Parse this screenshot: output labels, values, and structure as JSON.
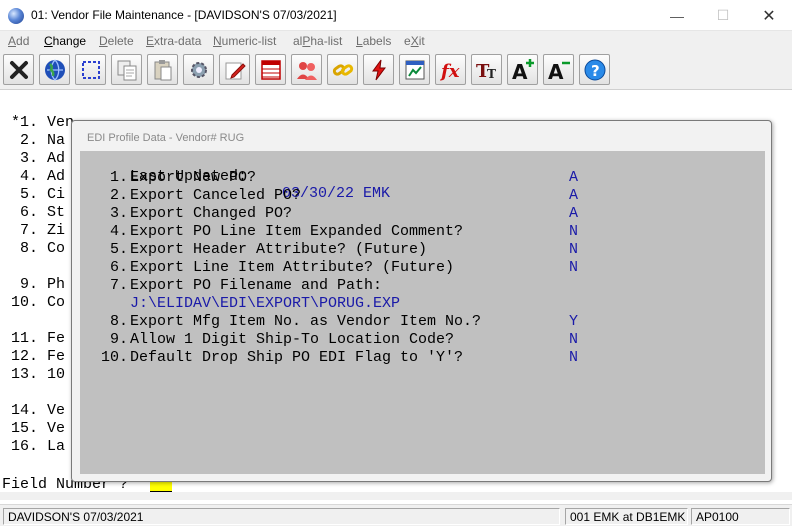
{
  "window": {
    "title": "01: Vendor File Maintenance - [DAVIDSON'S 07/03/2021]",
    "minimize_glyph": "—",
    "maximize_glyph": "☐",
    "close_glyph": "✕"
  },
  "menu": [
    {
      "label": "Add",
      "active": false
    },
    {
      "label": "Change",
      "active": true
    },
    {
      "label": "Delete",
      "active": false
    },
    {
      "label": "Extra-data",
      "active": false
    },
    {
      "label": "Numeric-list",
      "active": false
    },
    {
      "label": "alPha-list",
      "active": false
    },
    {
      "label": "Labels",
      "active": false
    },
    {
      "label": "eXit",
      "active": false
    }
  ],
  "toolbar": [
    {
      "icon": "close-x-icon"
    },
    {
      "icon": "globe-icon"
    },
    {
      "icon": "select-rectangle-icon"
    },
    {
      "icon": "copy-icon"
    },
    {
      "icon": "paste-icon"
    },
    {
      "icon": "settings-gear-icon"
    },
    {
      "icon": "edit-pencil-icon"
    },
    {
      "icon": "table-icon"
    },
    {
      "icon": "users-icon"
    },
    {
      "icon": "link-chain-icon"
    },
    {
      "icon": "lightning-icon"
    },
    {
      "icon": "chart-window-icon"
    },
    {
      "icon": "function-fx-icon"
    },
    {
      "icon": "font-style-icon"
    },
    {
      "icon": "font-increase-icon"
    },
    {
      "icon": "font-decrease-icon"
    },
    {
      "icon": "help-icon"
    }
  ],
  "background_fields": [
    {
      "text": "*1. Ven",
      "row": 0
    },
    {
      "text": " 2. Na",
      "row": 1
    },
    {
      "text": " 3. Ad",
      "row": 2
    },
    {
      "text": " 4. Ad",
      "row": 3
    },
    {
      "text": " 5. Ci",
      "row": 4
    },
    {
      "text": " 6. St",
      "row": 5
    },
    {
      "text": " 7. Zi",
      "row": 6
    },
    {
      "text": " 8. Co",
      "row": 7
    },
    {
      "text": " 9. Ph",
      "row": 9
    },
    {
      "text": "10. Co",
      "row": 10
    },
    {
      "text": "11. Fe",
      "row": 12
    },
    {
      "text": "12. Fe",
      "row": 13
    },
    {
      "text": "13. 10",
      "row": 14
    },
    {
      "text": "14. Ve",
      "row": 16
    },
    {
      "text": "15. Ve",
      "row": 17
    },
    {
      "text": "16. La",
      "row": 18
    }
  ],
  "field_prompt": "Field Number ?",
  "dialog": {
    "title": "EDI Profile Data - Vendor#  RUG",
    "last_updated_label": "Last Updated:",
    "last_updated_value": "03/30/22 EMK",
    "rows": [
      {
        "num": "1.",
        "label": "Export New PO?",
        "value": "A"
      },
      {
        "num": "2.",
        "label": "Export Canceled PO?",
        "value": "A"
      },
      {
        "num": "3.",
        "label": "Export Changed PO?",
        "value": "A"
      },
      {
        "num": "4.",
        "label": "Export PO Line Item Expanded Comment?",
        "value": "N"
      },
      {
        "num": "5.",
        "label": "Export Header Attribute? (Future)",
        "value": "N"
      },
      {
        "num": "6.",
        "label": "Export Line Item Attribute? (Future)",
        "value": "N"
      },
      {
        "num": "7.",
        "label": "Export PO Filename and Path:",
        "value": ""
      },
      {
        "num": "8.",
        "label": "Export Mfg Item No. as Vendor Item No.?",
        "value": "Y"
      },
      {
        "num": "9.",
        "label": "Allow 1 Digit Ship-To Location Code?",
        "value": "N"
      },
      {
        "num": "10.",
        "label": "Default Drop Ship PO EDI Flag to 'Y'?",
        "value": "N"
      }
    ],
    "path_value": "J:\\ELIDAV\\EDI\\EXPORT\\PORUG.EXP"
  },
  "status": {
    "company": "DAVIDSON'S 07/03/2021",
    "user": "001 EMK at DB1EMK",
    "program": "AP0100"
  }
}
